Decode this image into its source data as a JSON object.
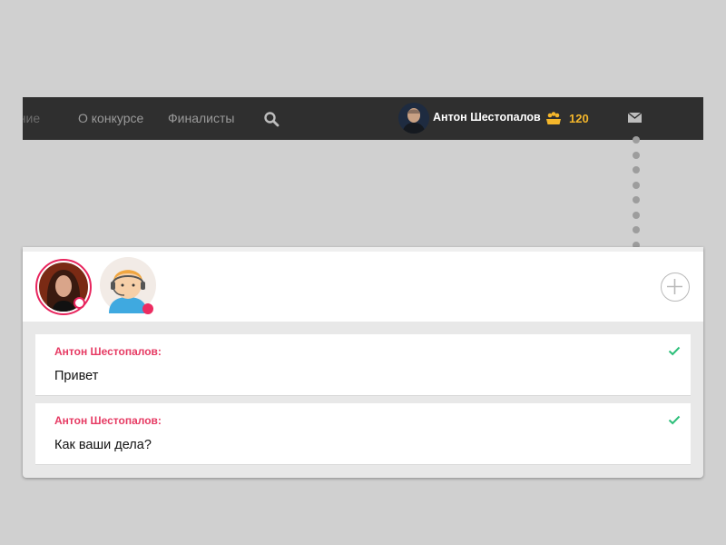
{
  "nav": {
    "items": [
      {
        "label": "ание"
      },
      {
        "label": "О конкурсе"
      },
      {
        "label": "Финалисты"
      }
    ],
    "icons": {
      "search": "search-icon",
      "coins": "coins-icon",
      "mail": "mail-icon"
    }
  },
  "user": {
    "name": "Антон Шестопалов",
    "coins": "120"
  },
  "chat": {
    "participants": [
      {
        "name": "avatar-woman",
        "status": "online-ring",
        "status_color": "#e8245d"
      },
      {
        "name": "avatar-support-operator",
        "status": "online-dot",
        "status_color": "#ec2c61"
      }
    ],
    "messages": [
      {
        "author": "Антон Шестопалов:",
        "text": "Привет",
        "status": "read"
      },
      {
        "author": "Антон Шестопалов:",
        "text": "Как ваши дела?",
        "status": "read"
      }
    ]
  },
  "colors": {
    "topbar": "#2f2f2f",
    "accent": "#e63a63",
    "coins": "#f5b72b",
    "check": "#2dbf7a",
    "background": "#d0d0d0"
  }
}
